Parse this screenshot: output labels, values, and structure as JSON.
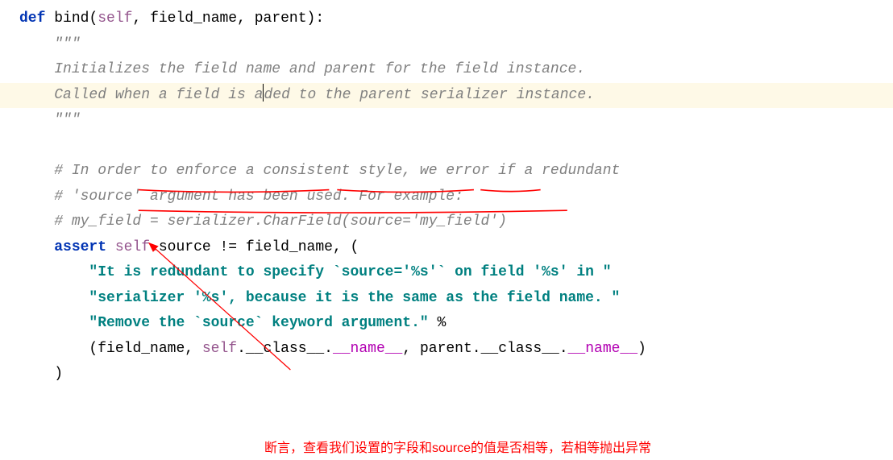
{
  "code": {
    "def_keyword": "def",
    "function_name": "bind",
    "param_self": "self",
    "param_field_name": "field_name",
    "param_parent": "parent",
    "triple_quote_open": "\"\"\"",
    "doc_line1": "Initializes the field name and parent for the field instance.",
    "doc_line2_before": "Called when a field is a",
    "doc_line2_after": "ded to the parent serializer instance.",
    "triple_quote_close": "\"\"\"",
    "comment1": "# In order to enforce a consistent style, we error if a redundant",
    "comment2": "# 'source' argument has been used. For example:",
    "comment3": "# my_field = serializer.CharField(source='my_field')",
    "assert_keyword": "assert",
    "assert_self": "self",
    "assert_source_attr": "source",
    "assert_ne": "!=",
    "assert_field_name": "field_name",
    "str_line1": "\"It is redundant to specify `source='%s'` on field '%s' in \"",
    "str_line2": "\"serializer '%s', because it is the same as the field name. \"",
    "str_line3": "\"Remove the `source` keyword argument.\"",
    "percent_op": "%",
    "tuple_field_name": "field_name",
    "tuple_self": "self",
    "tuple_class": "__class__",
    "tuple_name": "__name__",
    "tuple_parent": "parent"
  },
  "annotation": {
    "text": "断言，查看我们设置的字段和source的值是否相等，若相等抛出异常"
  }
}
